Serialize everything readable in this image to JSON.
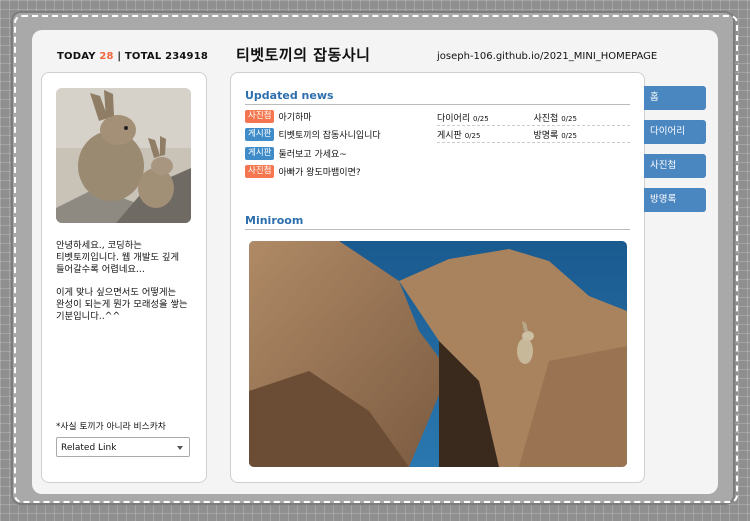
{
  "header": {
    "today_label": "TODAY",
    "today_count": "28",
    "separator": "|",
    "total_label": "TOTAL",
    "total_count": "234918",
    "title": "티벳토끼의 잡동사니",
    "url": "joseph-106.github.io/2021_MINI_HOMEPAGE"
  },
  "profile": {
    "intro_1": "안녕하세요., 코딩하는 티벳토끼입니다. 웹 개발도 깊게 들어갈수록 어렵네요...",
    "intro_2": "이게 맞나 싶으면서도 어떻게는 완성이 되는게 뭔가 모래성을 쌓는 기분입니다..^^",
    "fact": "*사실 토끼가 아니라 비스카차",
    "related_link": "Related Link"
  },
  "updated_news": {
    "title": "Updated news",
    "items": [
      {
        "badge": "사진첩",
        "badge_color": "#f4774f",
        "text": "아기하마"
      },
      {
        "badge": "게시판",
        "badge_color": "#3f8cc8",
        "text": "티벳토끼의 잡동사니입니다"
      },
      {
        "badge": "게시판",
        "badge_color": "#3f8cc8",
        "text": "둘러보고 가세요~"
      },
      {
        "badge": "사진첩",
        "badge_color": "#f4774f",
        "text": "아빠가 왕도마뱀이면?"
      }
    ],
    "stats": [
      {
        "label": "다이어리",
        "count": "0/25"
      },
      {
        "label": "사진첩",
        "count": "0/25"
      },
      {
        "label": "게시판",
        "count": "0/25"
      },
      {
        "label": "방명록",
        "count": "0/25"
      }
    ]
  },
  "miniroom": {
    "title": "Miniroom"
  },
  "tabs": [
    {
      "label": "홈"
    },
    {
      "label": "다이어리"
    },
    {
      "label": "사진첩"
    },
    {
      "label": "방명록"
    }
  ],
  "colors": {
    "accent": "#2d6fad",
    "tab": "#4a86c0",
    "today": "#f2653c"
  }
}
